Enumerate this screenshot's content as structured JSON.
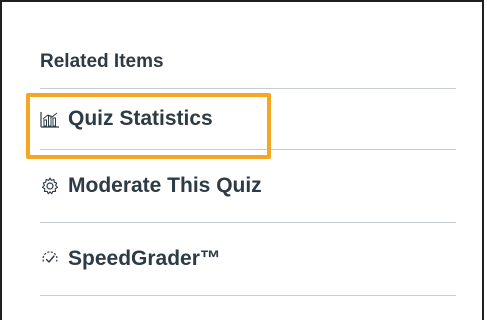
{
  "related_items": {
    "heading": "Related Items",
    "items": [
      {
        "label": "Quiz Statistics",
        "icon": "bar-chart-icon"
      },
      {
        "label": "Moderate This Quiz",
        "icon": "gear-icon"
      },
      {
        "label": "SpeedGrader™",
        "icon": "speedgrader-icon"
      }
    ]
  },
  "colors": {
    "text": "#2d3b45",
    "divider": "#c7cdd1",
    "highlight": "#f5a623"
  }
}
